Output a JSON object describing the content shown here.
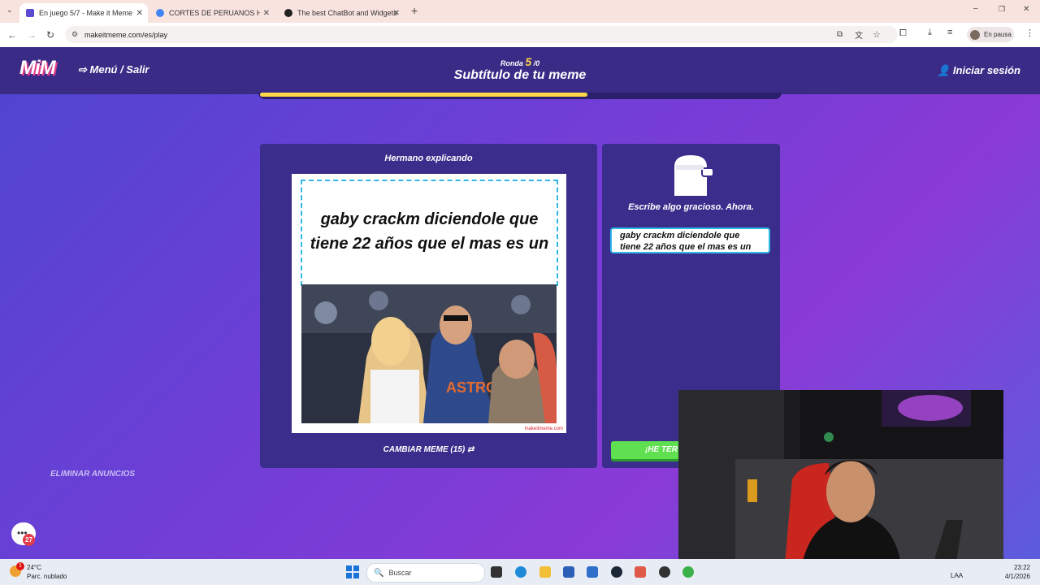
{
  "browser": {
    "tabs": [
      {
        "title": "En juego 5/7 - Make it Meme",
        "active": true
      },
      {
        "title": "CORTES DE PERUANOS HORRIB",
        "active": false
      },
      {
        "title": "The best ChatBot and Widgets",
        "active": false
      }
    ],
    "url": "makeitmeme.com/es/play",
    "profile_status": "En pausa"
  },
  "header": {
    "logo": "MiM",
    "menu_label": "Menú / Salir",
    "round_label": "Ronda",
    "round_current": "5",
    "round_total": "/0",
    "title": "Subtítulo de tu meme",
    "login_label": "Iniciar sesión"
  },
  "progress": {
    "value": 0.63
  },
  "meme": {
    "template_name": "Hermano explicando",
    "caption_text": "gaby crackm diciendole que tiene 22 años que el mas es un",
    "jersey_text": "ASTROS",
    "watermark": "makeitmeme.com",
    "change_label": "CAMBIAR MEME (15)"
  },
  "editor": {
    "prompt": "Escribe algo gracioso. Ahora.",
    "input_value": "gaby crackm diciendole que tiene 22 años que el mas es un",
    "done_label": "¡HE TER"
  },
  "ads": {
    "remove_label": "ELIMINAR ANUNCIOS"
  },
  "chat": {
    "badge_count": "27"
  },
  "taskbar": {
    "weather_temp": "24°C",
    "weather_desc": "Parc. nublado",
    "weather_badge": "1",
    "search_placeholder": "Buscar",
    "language": "LAA",
    "time": "23:22",
    "date": "4/1/2026"
  },
  "colors": {
    "accent_yellow": "#ffd84a",
    "panel": "#3b2d8c",
    "header": "#3a2b86",
    "done_green": "#5fe050",
    "input_border": "#30b8e6"
  }
}
